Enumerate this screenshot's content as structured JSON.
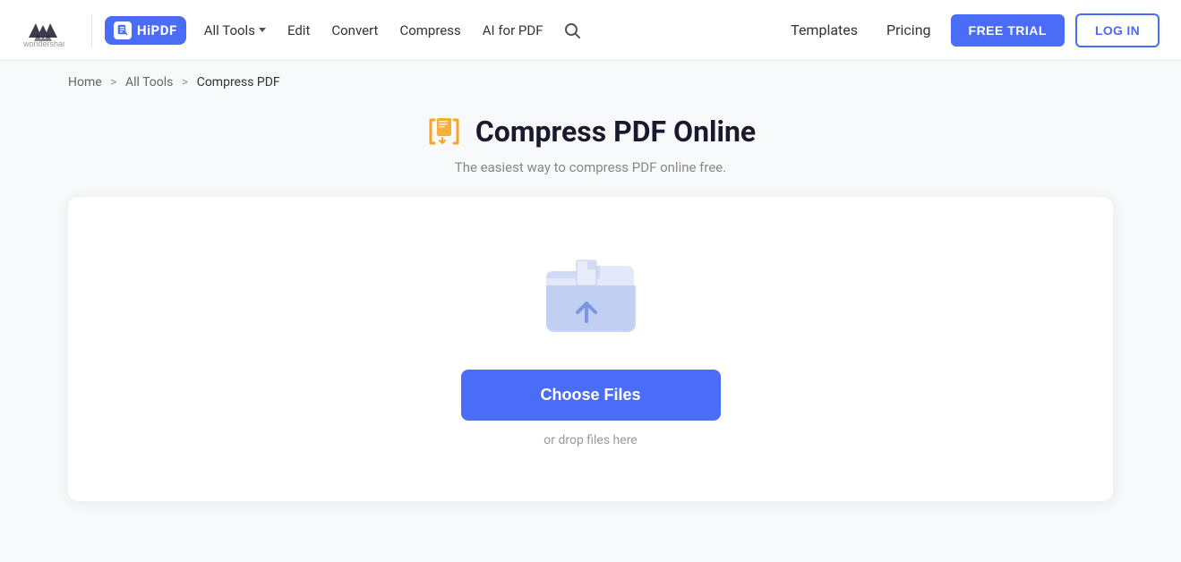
{
  "brand": {
    "wondershare_alt": "Wondershare",
    "hipdf_label": "HiPDF"
  },
  "nav": {
    "all_tools_label": "All Tools",
    "edit_label": "Edit",
    "convert_label": "Convert",
    "compress_label": "Compress",
    "ai_for_pdf_label": "AI for PDF",
    "templates_label": "Templates",
    "pricing_label": "Pricing",
    "free_trial_label": "FREE TRIAL",
    "login_label": "LOG IN"
  },
  "breadcrumb": {
    "home": "Home",
    "all_tools": "All Tools",
    "current": "Compress PDF"
  },
  "page": {
    "title": "Compress PDF Online",
    "subtitle": "The easiest way to compress PDF online free."
  },
  "upload": {
    "choose_files_label": "Choose Files",
    "drop_hint": "or drop files here"
  }
}
